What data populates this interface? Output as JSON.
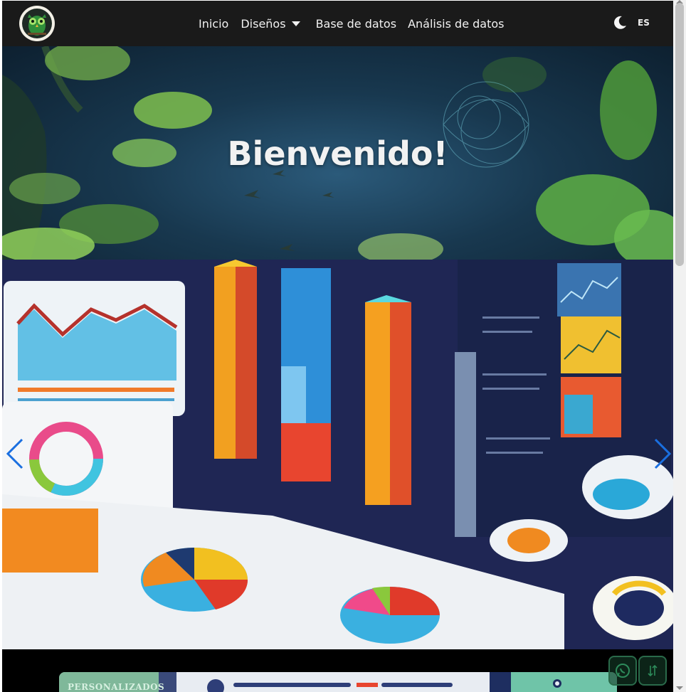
{
  "nav": {
    "links": [
      "Inicio",
      "Diseños",
      "Base de datos",
      "Análisis de datos"
    ],
    "language": "ES"
  },
  "hero": {
    "title": "Bienvenido!"
  },
  "bottom": {
    "card_label": "PERSONALIZADOS"
  },
  "icons": [
    "owl-logo-icon",
    "moon-icon",
    "chevron-left-icon",
    "chevron-right-icon",
    "whatsapp-icon",
    "sort-arrows-icon"
  ]
}
